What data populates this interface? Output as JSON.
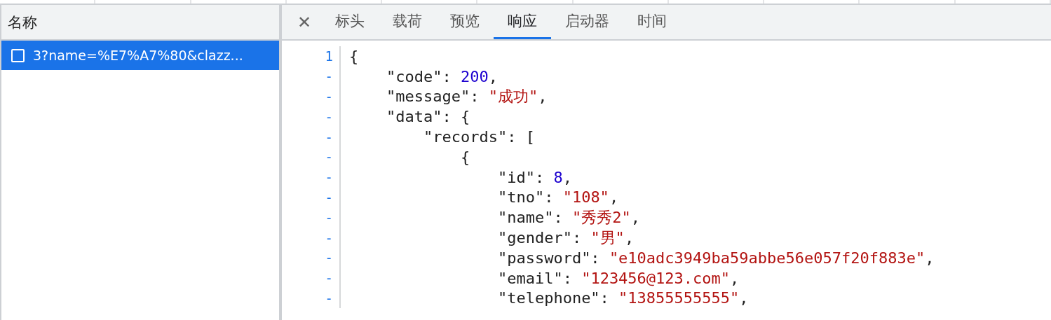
{
  "sidebar": {
    "header": "名称",
    "requests": [
      {
        "label": "3?name=%E7%A7%80&clazz...",
        "selected": true
      }
    ]
  },
  "detail": {
    "close": "✕",
    "tabs": [
      {
        "label": "标头",
        "selected": false
      },
      {
        "label": "载荷",
        "selected": false
      },
      {
        "label": "预览",
        "selected": false
      },
      {
        "label": "响应",
        "selected": true
      },
      {
        "label": "启动器",
        "selected": false
      },
      {
        "label": "时间",
        "selected": false
      }
    ],
    "response_lines": [
      {
        "number": "1",
        "tokens": [
          {
            "kind": "plain",
            "text": "{"
          }
        ]
      },
      {
        "number": "-",
        "tokens": [
          {
            "kind": "plain",
            "text": "    \"code\": "
          },
          {
            "kind": "number",
            "text": "200"
          },
          {
            "kind": "plain",
            "text": ","
          }
        ]
      },
      {
        "number": "-",
        "tokens": [
          {
            "kind": "plain",
            "text": "    \"message\": "
          },
          {
            "kind": "string",
            "text": "\"成功\""
          },
          {
            "kind": "plain",
            "text": ","
          }
        ]
      },
      {
        "number": "-",
        "tokens": [
          {
            "kind": "plain",
            "text": "    \"data\": {"
          }
        ]
      },
      {
        "number": "-",
        "tokens": [
          {
            "kind": "plain",
            "text": "        \"records\": ["
          }
        ]
      },
      {
        "number": "-",
        "tokens": [
          {
            "kind": "plain",
            "text": "            {"
          }
        ]
      },
      {
        "number": "-",
        "tokens": [
          {
            "kind": "plain",
            "text": "                \"id\": "
          },
          {
            "kind": "number",
            "text": "8"
          },
          {
            "kind": "plain",
            "text": ","
          }
        ]
      },
      {
        "number": "-",
        "tokens": [
          {
            "kind": "plain",
            "text": "                \"tno\": "
          },
          {
            "kind": "string",
            "text": "\"108\""
          },
          {
            "kind": "plain",
            "text": ","
          }
        ]
      },
      {
        "number": "-",
        "tokens": [
          {
            "kind": "plain",
            "text": "                \"name\": "
          },
          {
            "kind": "string",
            "text": "\"秀秀2\""
          },
          {
            "kind": "plain",
            "text": ","
          }
        ]
      },
      {
        "number": "-",
        "tokens": [
          {
            "kind": "plain",
            "text": "                \"gender\": "
          },
          {
            "kind": "string",
            "text": "\"男\""
          },
          {
            "kind": "plain",
            "text": ","
          }
        ]
      },
      {
        "number": "-",
        "tokens": [
          {
            "kind": "plain",
            "text": "                \"password\": "
          },
          {
            "kind": "string",
            "text": "\"e10adc3949ba59abbe56e057f20f883e\""
          },
          {
            "kind": "plain",
            "text": ","
          }
        ]
      },
      {
        "number": "-",
        "tokens": [
          {
            "kind": "plain",
            "text": "                \"email\": "
          },
          {
            "kind": "string",
            "text": "\"123456@123.com\""
          },
          {
            "kind": "plain",
            "text": ","
          }
        ]
      },
      {
        "number": "-",
        "tokens": [
          {
            "kind": "plain",
            "text": "                \"telephone\": "
          },
          {
            "kind": "string",
            "text": "\"13855555555\""
          },
          {
            "kind": "plain",
            "text": ","
          }
        ]
      }
    ]
  }
}
